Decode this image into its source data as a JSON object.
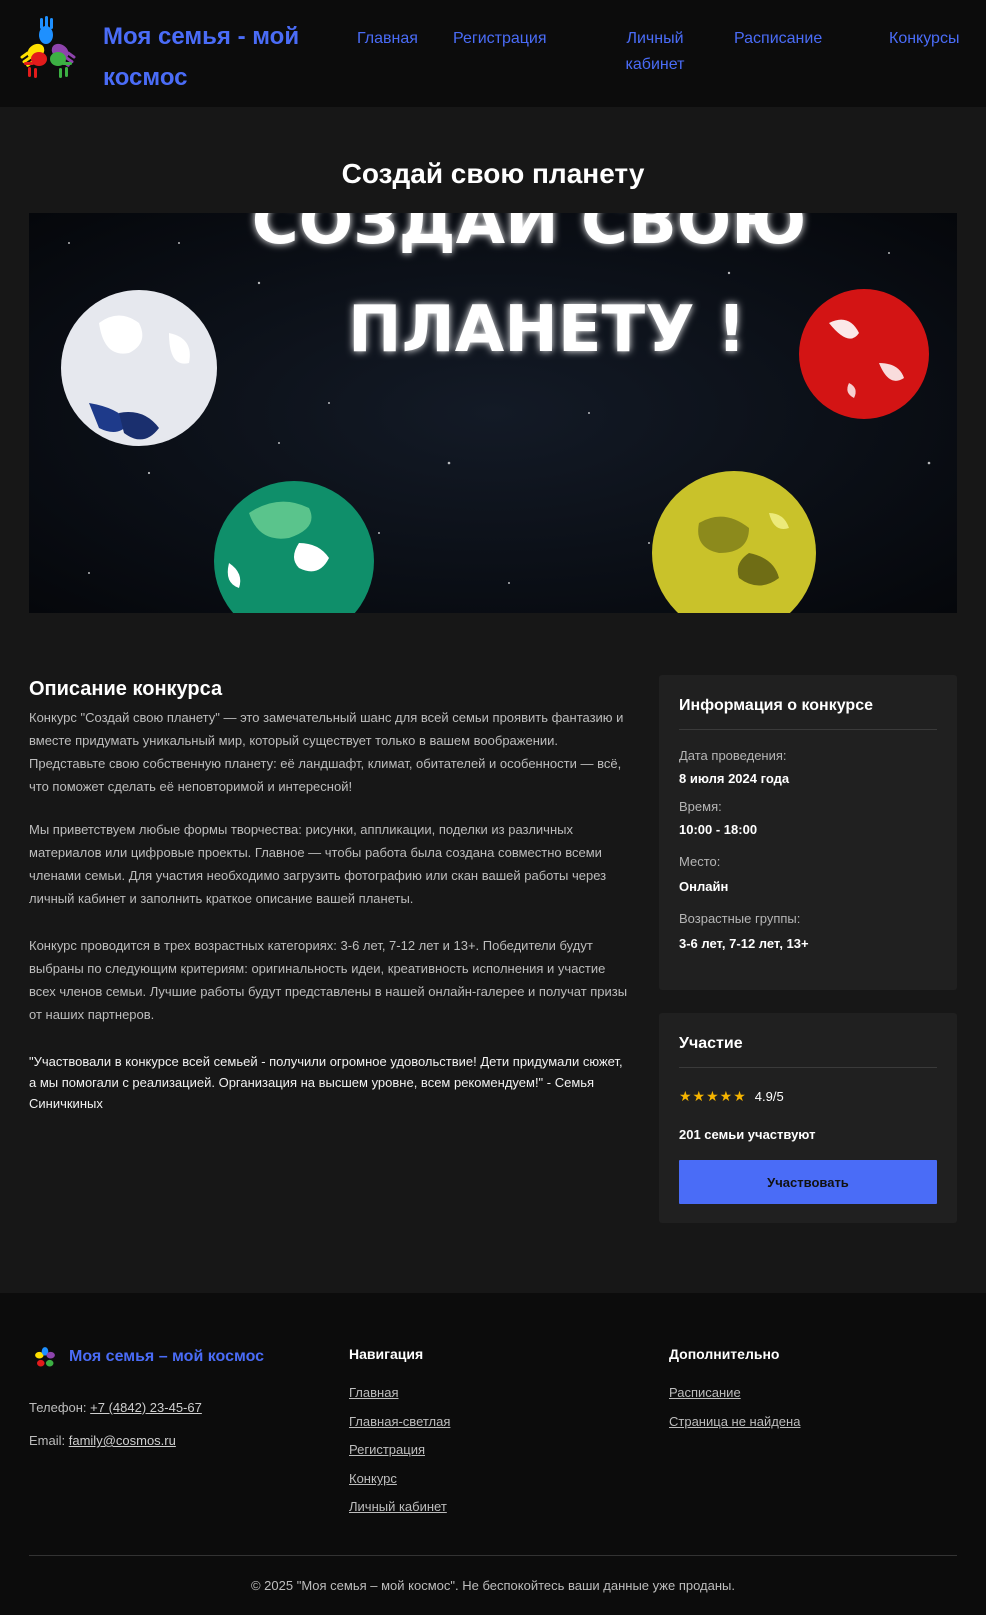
{
  "header": {
    "brand": "Моя семья - мой космос",
    "nav": [
      "Главная",
      "Регистрация",
      "Личный кабинет",
      "Расписание",
      "Конкурсы"
    ]
  },
  "main": {
    "title": "Создай свою планету",
    "hero": {
      "line1": "СОЗДАЙ СВОЮ",
      "line2": "ПЛАНЕТУ !"
    },
    "description": {
      "title": "Описание конкурса",
      "paragraphs": [
        "Конкурс \"Создай свою планету\" — это замечательный шанс для всей семьи проявить фантазию и вместе придумать уникальный мир, который существует только в вашем воображении. Представьте свою собственную планету: её ландшафт, климат, обитателей и особенности — всё, что поможет сделать её неповторимой и интересной!",
        "Мы приветствуем любые формы творчества: рисунки, аппликации, поделки из различных материалов или цифровые проекты. Главное — чтобы работа была создана совместно всеми членами семьи. Для участия необходимо загрузить фотографию или скан вашей работы через личный кабинет и заполнить краткое описание вашей планеты.",
        "Конкурс проводится в трех возрастных категориях: 3-6 лет, 7-12 лет и 13+. Победители будут выбраны по следующим критериям: оригинальность идеи, креативность исполнения и участие всех членов семьи. Лучшие работы будут представлены в нашей онлайн-галерее и получат призы от наших партнеров."
      ],
      "review": "\"Участвовали в конкурсе всей семьей - получили огромное удовольствие! Дети придумали сюжет, а мы помогали с реализацией. Организация на высшем уровне, всем рекомендуем!\" - Семья Синичкиных"
    },
    "info": {
      "title": "Информация о конкурсе",
      "items": [
        {
          "label": "Дата проведения:",
          "value": "8 июля 2024 года"
        },
        {
          "label": "Время:",
          "value": "10:00 - 18:00"
        },
        {
          "label": "Место:",
          "value": "Онлайн"
        },
        {
          "label": "Возрастные группы:",
          "value": "3-6 лет, 7-12 лет, 13+"
        }
      ]
    },
    "participation": {
      "title": "Участие",
      "stars": "★★★★★",
      "rating": "4.9/5",
      "count": "201 семьи участвуют",
      "button": "Участвовать"
    }
  },
  "footer": {
    "brand": "Моя семья – мой космос",
    "phone_label": "Телефон:",
    "phone": "+7 (4842) 23-45-67",
    "email_label": "Email:",
    "email": "family@cosmos.ru",
    "nav_heading": "Навигация",
    "nav_links": [
      "Главная",
      "Главная-светлая",
      "Регистрация",
      "Конкурс",
      "Личный кабинет"
    ],
    "extra_heading": "Дополнительно",
    "extra_links": [
      "Расписание",
      "Страница не найдена"
    ],
    "copyright": "© 2025 \"Моя семья – мой космос\". Не беспокойтесь ваши данные уже проданы."
  },
  "colors": {
    "accent": "#4a6cf7",
    "background": "#171717",
    "header": "#0c0c0c",
    "card": "#202020",
    "star": "#f5b400"
  }
}
